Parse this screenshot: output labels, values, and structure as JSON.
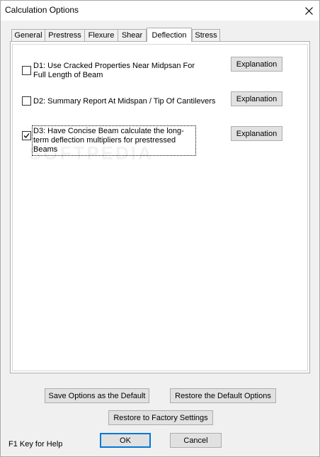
{
  "window": {
    "title": "Calculation Options"
  },
  "tabs": [
    {
      "label": "General"
    },
    {
      "label": "Prestress"
    },
    {
      "label": "Flexure"
    },
    {
      "label": "Shear"
    },
    {
      "label": "Deflection",
      "active": true
    },
    {
      "label": "Stress"
    }
  ],
  "options": [
    {
      "label": "D1: Use Cracked Properties Near Midpsan For Full Length of Beam",
      "checked": false,
      "button": "Explanation"
    },
    {
      "label": "D2: Summary Report At Midspan / Tip Of Cantilevers",
      "checked": false,
      "button": "Explanation"
    },
    {
      "label": "D3: Have Concise Beam calculate the long-term deflection multipliers for prestressed Beams",
      "checked": true,
      "button": "Explanation"
    }
  ],
  "buttons": {
    "save_default": "Save Options as the Default",
    "restore_default": "Restore the Default Options",
    "restore_factory": "Restore to Factory Settings",
    "ok": "OK",
    "cancel": "Cancel"
  },
  "help_text": "F1 Key for Help",
  "watermark": "SOFTPEDIA",
  "colors": {
    "focus_border": "#0078d7",
    "panel": "#ffffff",
    "dialog": "#f0f0f0"
  }
}
